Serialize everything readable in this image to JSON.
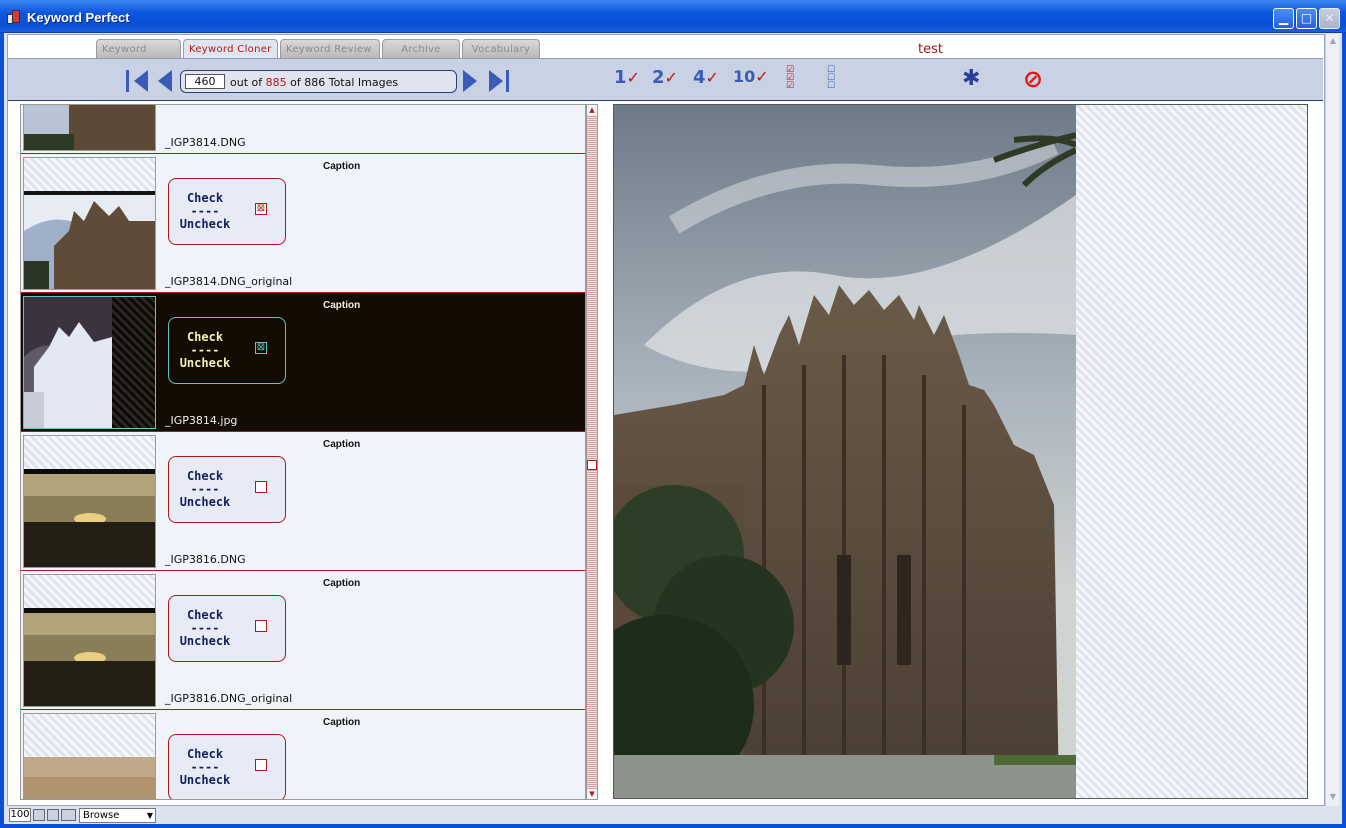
{
  "window": {
    "title": "Keyword Perfect",
    "min_glyph": "▁",
    "max_glyph": "□",
    "close_glyph": "✕"
  },
  "tabs": [
    {
      "label": "Keyword Entry",
      "active": false
    },
    {
      "label": "Keyword Cloner",
      "active": true
    },
    {
      "label": "Keyword Review",
      "active": false
    },
    {
      "label": "Archive",
      "active": false
    },
    {
      "label": "Vocabulary",
      "active": false
    }
  ],
  "header": {
    "title": "test"
  },
  "navigator": {
    "current": "460",
    "out_of_label": "out of",
    "selected_total": "885",
    "of_label": "of 886 Total Images"
  },
  "toolbar_icons": [
    {
      "name": "check-1-icon",
      "num": "1",
      "mark": "✓"
    },
    {
      "name": "check-2-icon",
      "num": "2",
      "mark": "✓"
    },
    {
      "name": "check-4-icon",
      "num": "4",
      "mark": "✓"
    },
    {
      "name": "check-10-icon",
      "num": "10",
      "mark": "✓"
    },
    {
      "name": "check-all-icon",
      "num": "",
      "mark": "☑"
    },
    {
      "name": "uncheck-all-icon",
      "num": "",
      "mark": "☐"
    },
    {
      "name": "settings-gear-icon",
      "num": "",
      "mark": "✱"
    },
    {
      "name": "cancel-icon",
      "num": "",
      "mark": "⊘"
    }
  ],
  "list": {
    "caption_label": "Caption",
    "check_label": "Check",
    "dash_label": "----",
    "uncheck_label": "Uncheck",
    "rows": [
      {
        "filename": "_IGP3814.DNG",
        "checked": false,
        "selected": false,
        "partial": true
      },
      {
        "filename": "_IGP3814.DNG_original",
        "checked": true,
        "selected": false
      },
      {
        "filename": "_IGP3814.jpg",
        "checked": true,
        "selected": true
      },
      {
        "filename": "_IGP3816.DNG",
        "checked": false,
        "selected": false
      },
      {
        "filename": "_IGP3816.DNG_original",
        "checked": false,
        "selected": false
      },
      {
        "filename": "",
        "checked": false,
        "selected": false
      }
    ]
  },
  "status_bar": {
    "zoom": "100",
    "mode": "Browse"
  },
  "colors": {
    "accent_red": "#b01818",
    "nav_blue": "#3a5bb8",
    "toolbar_bg": "#c8d2e4"
  }
}
